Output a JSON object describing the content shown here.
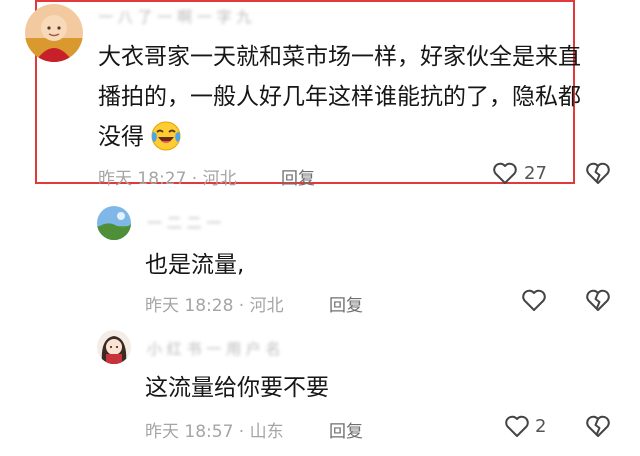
{
  "comments": [
    {
      "username": "一 八 了 一 啊 一 字 九",
      "text_line1": "大衣哥家一天就和菜市场一样，好家伙全是来直",
      "text_line2": "播拍的，一般人好几年这样谁能抗的了，隐私都",
      "text_line3": "没得",
      "emoji": "laughing-crying-emoji",
      "time": "昨天 18:27 · 河北",
      "reply_label": "回复",
      "like_count": "27",
      "highlight_color": "#e23a3a"
    },
    {
      "username": "一 二 二 一",
      "text": "也是流量,",
      "time": "昨天 18:28 · 河北",
      "reply_label": "回复",
      "like_count": ""
    },
    {
      "username": "小 红 书 一 用 户 名",
      "text": "这流量给你要不要",
      "time": "昨天 18:57 · 山东",
      "reply_label": "回复",
      "like_count": "2"
    }
  ]
}
